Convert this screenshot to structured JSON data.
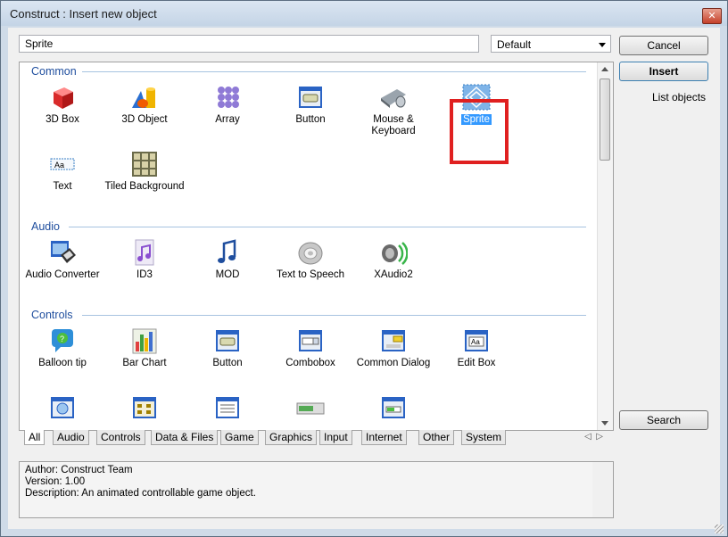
{
  "window": {
    "title": "Construct : Insert new object",
    "close": "✕"
  },
  "search": {
    "value": "Sprite"
  },
  "filter": {
    "selected": "Default"
  },
  "buttons": {
    "cancel": "Cancel",
    "insert": "Insert",
    "search": "Search",
    "list_objects": "List objects"
  },
  "categories": [
    {
      "name": "Common",
      "items": [
        "3D Box",
        "3D Object",
        "Array",
        "Button",
        "Mouse & Keyboard",
        "Sprite",
        "Text",
        "Tiled Background"
      ]
    },
    {
      "name": "Audio",
      "items": [
        "Audio Converter",
        "ID3",
        "MOD",
        "Text to Speech",
        "XAudio2"
      ]
    },
    {
      "name": "Controls",
      "items": [
        "Balloon tip",
        "Bar Chart",
        "Button",
        "Combobox",
        "Common Dialog",
        "Edit Box"
      ]
    }
  ],
  "tabs": [
    "All",
    "Audio",
    "Controls",
    "Data & Files",
    "Game",
    "Graphics",
    "Input",
    "Internet",
    "Other",
    "System"
  ],
  "description": {
    "author": "Author: Construct Team",
    "version": "Version: 1.00",
    "text": "Description: An animated controllable game object."
  },
  "colors": {
    "category_text": "#1f4e9e",
    "selection_box": "#e02020",
    "selected_label_bg": "#3399ff"
  }
}
